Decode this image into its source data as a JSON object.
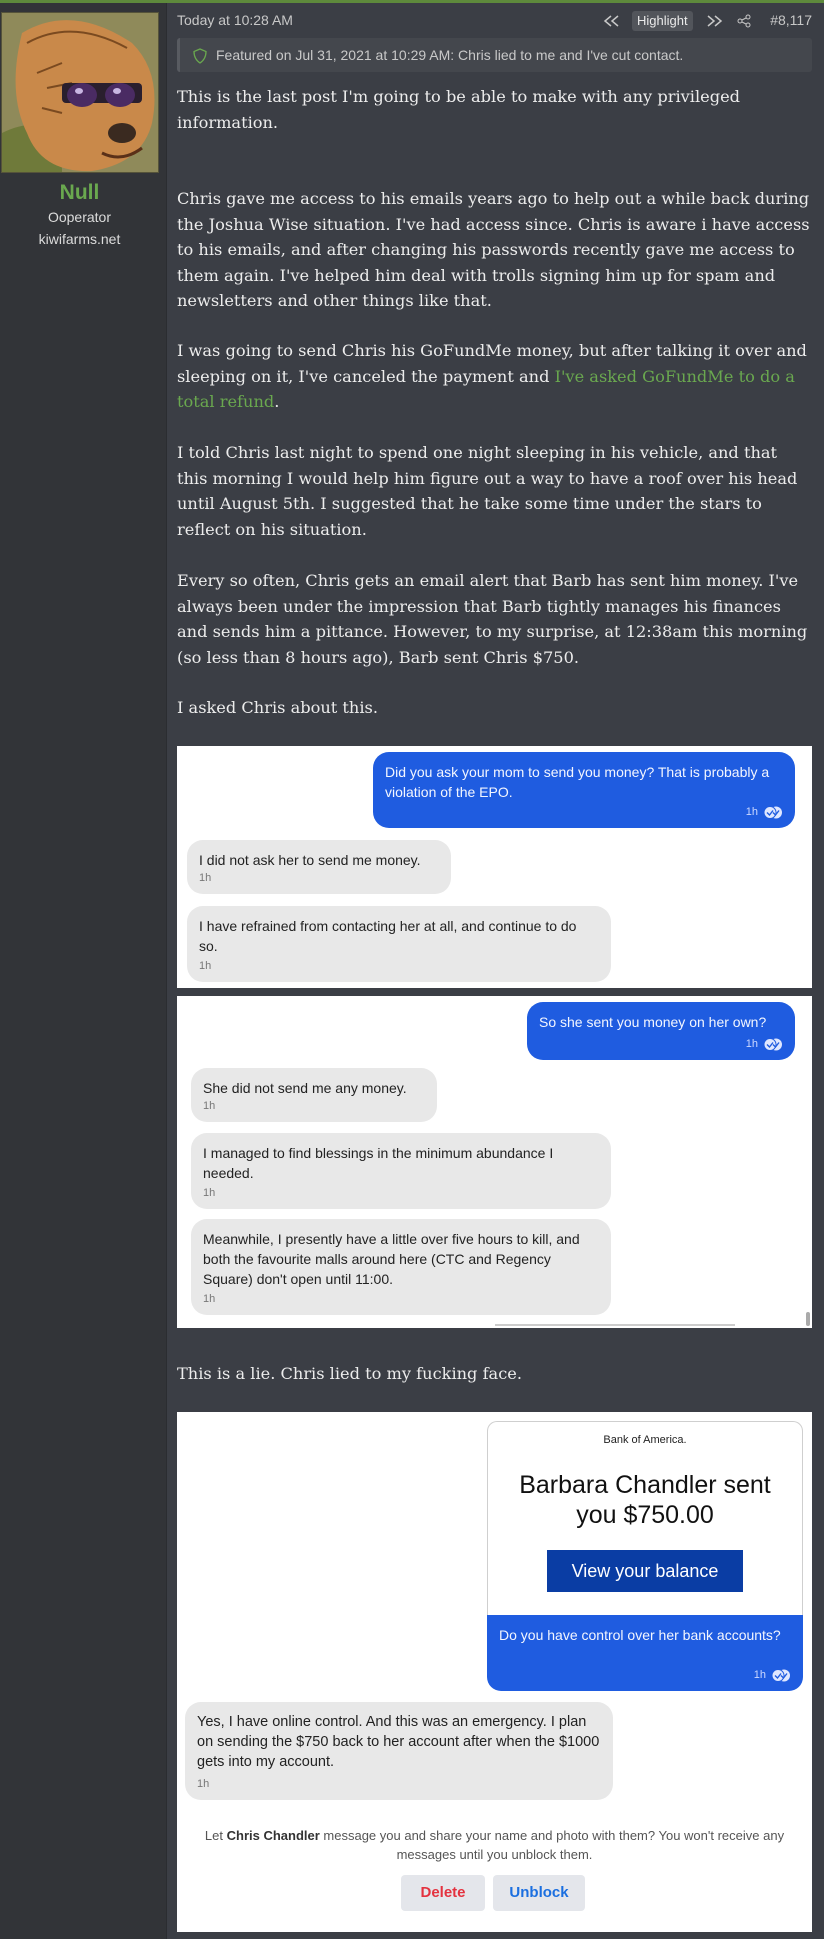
{
  "user": {
    "name": "Null",
    "title": "Ooperator",
    "site": "kiwifarms.net",
    "name_color": "#6aa84f"
  },
  "post": {
    "time": "Today at 10:28 AM",
    "highlight_label": "Highlight",
    "post_number": "#8,117",
    "featured_text": "Featured on Jul 31, 2021 at 10:29 AM: Chris lied to me and I've cut contact.",
    "paragraphs": {
      "p1": "This is the last post I'm going to be able to make with any privileged information.",
      "p2": "Chris gave me access to his emails years ago to help out a while back during the Joshua Wise situation. I've had access since. Chris is aware i have access to his emails, and after changing his passwords recently gave me access to them again. I've helped him deal with trolls signing him up for spam and newsletters and other things like that.",
      "p3_before": "I was going to send Chris his GoFundMe money, but after talking it over and sleeping on it, I've canceled the payment and ",
      "p3_link": "I've asked GoFundMe to do a total refund",
      "p3_after": ".",
      "p4": "I told Chris last night to spend one night sleeping in his vehicle, and that this morning I would help him figure out a way to have a roof over his head until August 5th. I suggested that he take some time under the stars to reflect on his situation.",
      "p5": "Every so often, Chris gets an email alert that Barb has sent him money. I've always been under the impression that Barb tightly manages his finances and sends him a pittance. However, to my surprise, at 12:38am this morning (so less than 8 hours ago), Barb sent Chris $750.",
      "p6": "I asked Chris about this.",
      "p7": "This is a lie. Chris lied to my fucking face."
    }
  },
  "chat1": {
    "m1": "Did you ask your mom to send you money? That is probably a violation of the EPO.",
    "m2": "I did not ask her to send me money.",
    "m3": "I have refrained from contacting her at all, and continue to do so.",
    "time": "1h"
  },
  "chat2": {
    "m1": "So she sent you money on her own?",
    "m2": "She did not send me any money.",
    "m3": "I managed to find blessings in the minimum abundance I needed.",
    "m4": "Meanwhile, I presently have a little over five hours to kill, and both the favourite malls around here (CTC and Regency Square) don't open until 11:00.",
    "time": "1h"
  },
  "chat3": {
    "bofa_brand": "Bank of America.",
    "bofa_title": "Barbara Chandler sent you $750.00",
    "bofa_button": "View your balance",
    "m1": "Do you have control over her bank accounts?",
    "m2": "Yes, I have online control.  And this was an emergency.  I plan on sending the $750 back to her account after when the $1000 gets into my account.",
    "time": "1h",
    "block_before": "Let ",
    "block_name": "Chris Chandler",
    "block_after": " message you and share your name and photo with them? You won't receive any messages until you unblock them.",
    "delete_label": "Delete",
    "unblock_label": "Unblock",
    "delete_color": "#e4323f",
    "unblock_color": "#1b6fe0"
  },
  "colors": {
    "background": "#3b3e45",
    "sidebar": "#323438",
    "accent": "#6aa84f",
    "messenger_blue": "#1f5ce0"
  }
}
